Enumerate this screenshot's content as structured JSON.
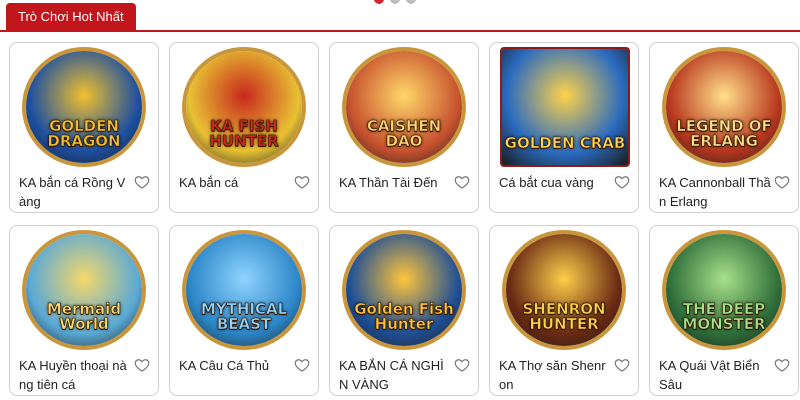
{
  "header": {
    "tab_label": "Trò Chơi Hot Nhất",
    "carousel_dots": 3,
    "active_dot": 0
  },
  "games": [
    {
      "title": "KA bắn cá Rồng Vàng",
      "logo": "GOLDEN DRAGON",
      "bg": "#1d4fa0",
      "fg": "#f2c12e",
      "icon": "favorite-heart-icon"
    },
    {
      "title": "KA bắn cá",
      "logo": "KA FISH HUNTER",
      "bg": "#e8c233",
      "fg": "#c8281e",
      "icon": "favorite-heart-icon"
    },
    {
      "title": "KA Thần Tài Đến",
      "logo": "CAISHEN DAO",
      "bg": "#c7522e",
      "fg": "#ffd86a",
      "icon": "favorite-heart-icon"
    },
    {
      "title": "Cá bắt cua vàng",
      "logo": "GOLDEN CRAB",
      "bg": "#2a6bc0",
      "fg": "#ffd34a",
      "icon": "favorite-heart-icon"
    },
    {
      "title": "KA Cannonball Thần Erlang",
      "logo": "LEGEND OF ERLANG",
      "bg": "#b8371f",
      "fg": "#ffe08a",
      "icon": "favorite-heart-icon"
    },
    {
      "title": "KA Huyền thoại nàng tiên cá",
      "logo": "Mermaid World",
      "bg": "#5aa9d6",
      "fg": "#f6d86b",
      "icon": "favorite-heart-icon"
    },
    {
      "title": "KA Câu Cá Thủ",
      "logo": "MYTHICAL BEAST",
      "bg": "#2c86c8",
      "fg": "#8fd4ff",
      "icon": "favorite-heart-icon"
    },
    {
      "title": "KA BẮN CÁ NGHÌN VÀNG",
      "logo": "Golden Fish Hunter",
      "bg": "#1f4f96",
      "fg": "#ffc53a",
      "icon": "favorite-heart-icon"
    },
    {
      "title": "KA Thợ săn Shenron",
      "logo": "SHENRON HUNTER",
      "bg": "#6a2a14",
      "fg": "#ffcf4a",
      "icon": "favorite-heart-icon"
    },
    {
      "title": "KA Quái Vật Biển Sâu",
      "logo": "THE DEEP MONSTER",
      "bg": "#2f6e3a",
      "fg": "#a8e08a",
      "icon": "favorite-heart-icon"
    }
  ]
}
